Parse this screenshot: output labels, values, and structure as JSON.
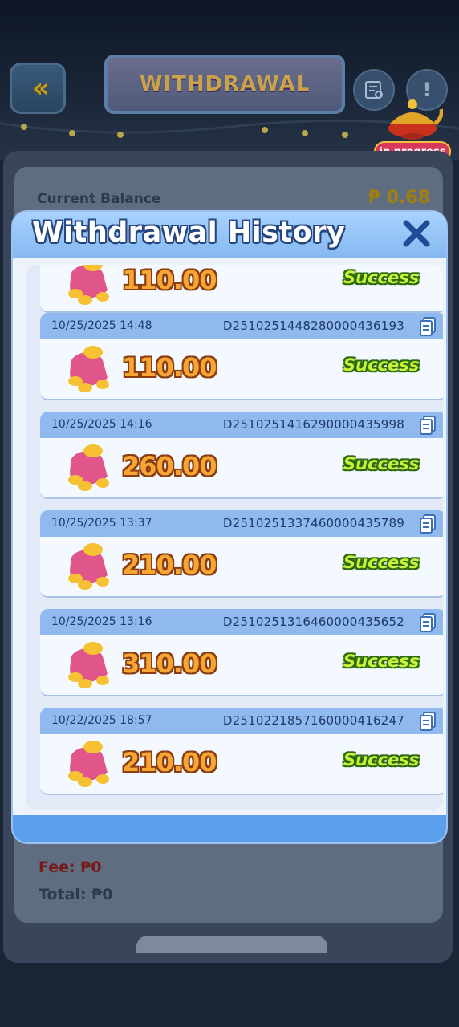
{
  "header": {
    "title": "WITHDRAWAL",
    "progress_badge": "in progress"
  },
  "balance": {
    "label": "Current Balance",
    "value": "₱ 0.68"
  },
  "fees": {
    "fee": "Fee: ₱0",
    "total": "Total: ₱0"
  },
  "modal": {
    "title": "Withdrawal History",
    "records": [
      {
        "date": "",
        "id": "",
        "amount": "110.00",
        "status": "Success"
      },
      {
        "date": "10/25/2025 14:48",
        "id": "D2510251448280000436193",
        "amount": "110.00",
        "status": "Success"
      },
      {
        "date": "10/25/2025 14:16",
        "id": "D2510251416290000435998",
        "amount": "260.00",
        "status": "Success"
      },
      {
        "date": "10/25/2025 13:37",
        "id": "D2510251337460000435789",
        "amount": "210.00",
        "status": "Success"
      },
      {
        "date": "10/25/2025 13:16",
        "id": "D2510251316460000435652",
        "amount": "310.00",
        "status": "Success"
      },
      {
        "date": "10/22/2025 18:57",
        "id": "D2510221857160000416247",
        "amount": "210.00",
        "status": "Success"
      }
    ]
  },
  "colors": {
    "amount": "#f7a635",
    "status": "#c8f33a",
    "header_blue": "#8fb9ef"
  },
  "icons": [
    "back-arrow-icon",
    "record-icon",
    "info-icon",
    "lamp-icon",
    "close-icon",
    "copy-icon",
    "purse-icon"
  ]
}
